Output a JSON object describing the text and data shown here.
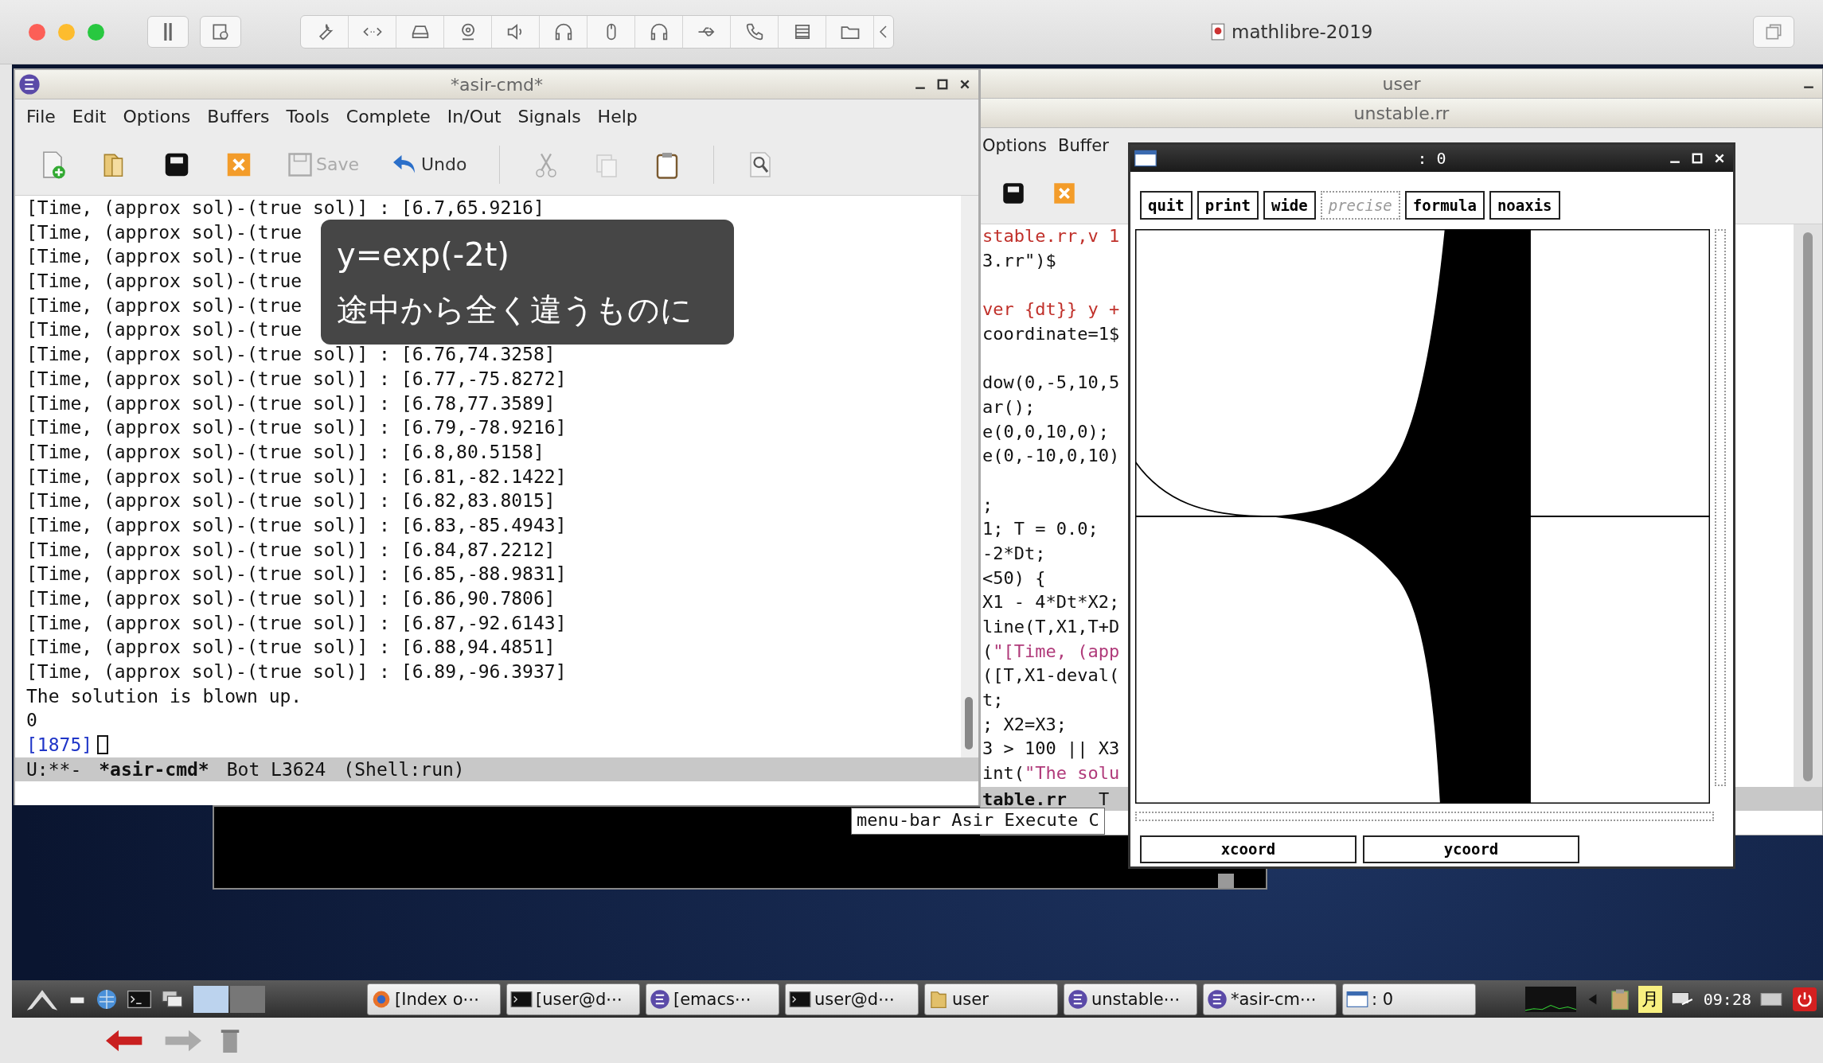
{
  "host_window": {
    "title": "mathlibre-2019"
  },
  "caption": {
    "lines": [
      "y=exp(-2t)",
      "途中から全く違うものに"
    ]
  },
  "asir_window": {
    "title": "*asir-cmd*",
    "menu": [
      "File",
      "Edit",
      "Options",
      "Buffers",
      "Tools",
      "Complete",
      "In/Out",
      "Signals",
      "Help"
    ],
    "toolbar": [
      {
        "label": "Save",
        "disabled": true
      },
      {
        "label": "Undo",
        "disabled": false
      }
    ],
    "output_lines": [
      "[Time, (approx sol)-(true sol)] : [6.7,65.9216]",
      "[Time, (approx sol)-(true",
      "[Time, (approx sol)-(true",
      "[Time, (approx sol)-(true",
      "[Time, (approx sol)-(true",
      "[Time, (approx sol)-(true",
      "[Time, (approx sol)-(true sol)] : [6.76,74.3258]",
      "[Time, (approx sol)-(true sol)] : [6.77,-75.8272]",
      "[Time, (approx sol)-(true sol)] : [6.78,77.3589]",
      "[Time, (approx sol)-(true sol)] : [6.79,-78.9216]",
      "[Time, (approx sol)-(true sol)] : [6.8,80.5158]",
      "[Time, (approx sol)-(true sol)] : [6.81,-82.1422]",
      "[Time, (approx sol)-(true sol)] : [6.82,83.8015]",
      "[Time, (approx sol)-(true sol)] : [6.83,-85.4943]",
      "[Time, (approx sol)-(true sol)] : [6.84,87.2212]",
      "[Time, (approx sol)-(true sol)] : [6.85,-88.9831]",
      "[Time, (approx sol)-(true sol)] : [6.86,90.7806]",
      "[Time, (approx sol)-(true sol)] : [6.87,-92.6143]",
      "[Time, (approx sol)-(true sol)] : [6.88,94.4851]",
      "[Time, (approx sol)-(true sol)] : [6.89,-96.3937]",
      "The solution is blown up.",
      "0"
    ],
    "prompt": "[1875]",
    "mode_line": {
      "status": "U:**-",
      "buffer": "*asir-cmd*",
      "position": "Bot L3624",
      "mode": "(Shell:run)"
    }
  },
  "user_window": {
    "title": "user"
  },
  "source_window": {
    "title": "unstable.rr",
    "menu": [
      "Options",
      "Buffer"
    ],
    "code_lines": [
      {
        "blank_before": false,
        "segments": [
          {
            "text": "stable.rr,v 1",
            "kind": "comment"
          }
        ]
      },
      {
        "blank_before": false,
        "segments": [
          {
            "text": "3.rr\")$",
            "kind": "code"
          }
        ]
      },
      {
        "blank_before": true,
        "segments": [
          {
            "text": "ver {dt}} y +",
            "kind": "comment"
          }
        ]
      },
      {
        "blank_before": false,
        "segments": [
          {
            "text": "coordinate=1$",
            "kind": "code"
          }
        ]
      },
      {
        "blank_before": true,
        "segments": [
          {
            "text": "dow(0,-5,10,5",
            "kind": "code"
          }
        ]
      },
      {
        "blank_before": false,
        "segments": [
          {
            "text": "ar();",
            "kind": "code"
          }
        ]
      },
      {
        "blank_before": false,
        "segments": [
          {
            "text": "e(0,0,10,0);",
            "kind": "code"
          }
        ]
      },
      {
        "blank_before": false,
        "segments": [
          {
            "text": "e(0,-10,0,10)",
            "kind": "code"
          }
        ]
      },
      {
        "blank_before": true,
        "segments": [
          {
            "text": ";",
            "kind": "code"
          }
        ]
      },
      {
        "blank_before": false,
        "segments": [
          {
            "text": "1; T = 0.0;",
            "kind": "code"
          }
        ]
      },
      {
        "blank_before": false,
        "segments": [
          {
            "text": "-2*Dt;",
            "kind": "code"
          }
        ]
      },
      {
        "blank_before": false,
        "segments": [
          {
            "text": "<50) {",
            "kind": "code"
          }
        ]
      },
      {
        "blank_before": false,
        "segments": [
          {
            "text": "X1 - 4*Dt*X2;",
            "kind": "code"
          }
        ]
      },
      {
        "blank_before": false,
        "segments": [
          {
            "text": "line(T,X1,T+D",
            "kind": "code"
          }
        ]
      },
      {
        "blank_before": false,
        "segments": [
          {
            "text": "(",
            "kind": "code"
          },
          {
            "text": "\"[Time, (app",
            "kind": "string"
          }
        ]
      },
      {
        "blank_before": false,
        "segments": [
          {
            "text": "([T,X1-deval(",
            "kind": "code"
          }
        ]
      },
      {
        "blank_before": false,
        "segments": [
          {
            "text": "t;",
            "kind": "code"
          }
        ]
      },
      {
        "blank_before": false,
        "segments": [
          {
            "text": "; X2=X3;",
            "kind": "code"
          }
        ]
      },
      {
        "blank_before": false,
        "segments": [
          {
            "text": "3 > 100 || X3",
            "kind": "code"
          }
        ]
      },
      {
        "blank_before": false,
        "segments": [
          {
            "text": "int(",
            "kind": "code"
          },
          {
            "text": "\"The solu",
            "kind": "string"
          }
        ]
      }
    ],
    "mode_line": {
      "buffer": "table.rr",
      "rest": "T"
    }
  },
  "tooltip": "menu-bar Asir Execute C",
  "plot_window": {
    "title": ": 0",
    "buttons": [
      {
        "label": "quit",
        "disabled": false
      },
      {
        "label": "print",
        "disabled": false
      },
      {
        "label": "wide",
        "disabled": false
      },
      {
        "label": "precise",
        "disabled": true
      },
      {
        "label": "formula",
        "disabled": false
      },
      {
        "label": "noaxis",
        "disabled": false
      }
    ],
    "coord_fields": [
      "xcoord",
      "ycoord"
    ]
  },
  "taskbar": {
    "tasks": [
      {
        "label": "[Index o⋯",
        "kind": "browser"
      },
      {
        "label": "[user@d⋯",
        "kind": "terminal"
      },
      {
        "label": "[emacs⋯",
        "kind": "emacs"
      },
      {
        "label": "user@d⋯",
        "kind": "terminal"
      },
      {
        "label": "user",
        "kind": "folder"
      },
      {
        "label": "unstable⋯",
        "kind": "emacs"
      },
      {
        "label": "*asir-cm⋯",
        "kind": "emacs"
      },
      {
        "label": ": 0",
        "kind": "window"
      }
    ],
    "input_method": "月",
    "clock": "09:28"
  }
}
